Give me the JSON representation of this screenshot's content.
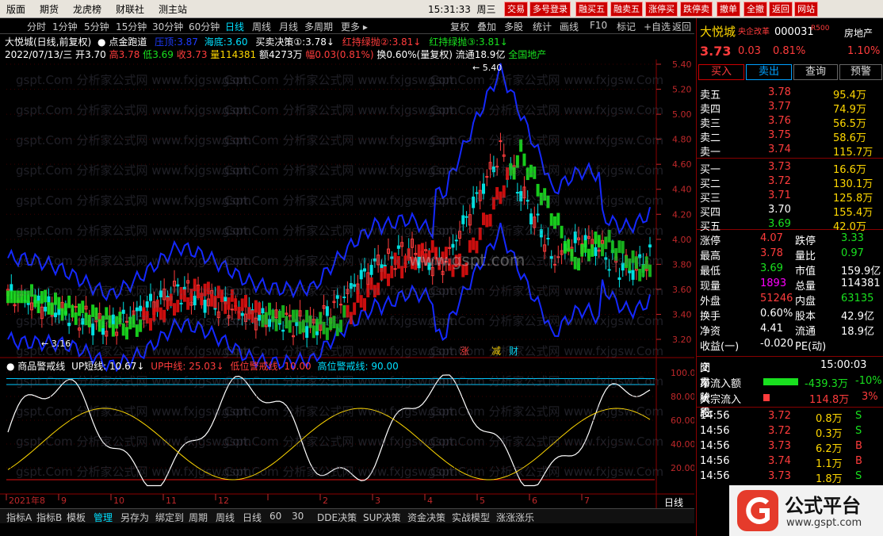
{
  "menu": {
    "items": [
      "版面",
      "期货",
      "龙虎榜",
      "财联社",
      "测主站"
    ],
    "clock": "15:31:33",
    "weekday": "周三"
  },
  "top_buttons": [
    "交易",
    "多号登录",
    "融买五",
    "融卖五",
    "涨停买",
    "跌停卖",
    "撤单",
    "全撤",
    "返回",
    "网站"
  ],
  "toolbar": {
    "items": [
      "分时",
      "1分钟",
      "5分钟",
      "15分钟",
      "30分钟",
      "60分钟",
      "日线",
      "周线",
      "月线",
      "多周期",
      "更多"
    ],
    "active": "日线",
    "right_items": [
      "复权",
      "叠加",
      "多股",
      "统计",
      "画线",
      "F10",
      "标记",
      "+自选",
      "返回"
    ]
  },
  "chart_header": {
    "title": "大悦城(日线,前复权)",
    "indicator": "点金跑道",
    "v1_label": "压顶:",
    "v1": "3.87",
    "v2_label": "海底:",
    "v2": "3.60",
    "v3_label": "买卖决策①:",
    "v3": "3.78",
    "v4_label": "红持绿抛②:",
    "v4": "3.81",
    "v5_label": "红持绿抛③:",
    "v5": "3.81",
    "date": "2022/07/13/三",
    "open_label": "开",
    "open": "3.70",
    "high_label": "高",
    "high": "3.78",
    "low_label": "低",
    "low": "3.69",
    "close_label": "收",
    "close": "3.73",
    "vol_label": "量",
    "vol": "114381",
    "amt_label": "额",
    "amt": "4273万",
    "chg_label": "幅",
    "chg": "0.03(0.81%)",
    "turn": "换0.60%(量复权)",
    "float": "流通18.9亿",
    "sector": "全国地产"
  },
  "price_axis": [
    "5.40",
    "5.20",
    "5.00",
    "4.80",
    "4.60",
    "4.40",
    "4.20",
    "4.00",
    "3.80",
    "3.60",
    "3.40",
    "3.20"
  ],
  "annotations": {
    "max": "5.40",
    "min": "3.16",
    "tags": [
      "涨",
      "减",
      "财"
    ],
    "site": "www.gspt.com"
  },
  "sub_indicator": {
    "name": "商品警戒线",
    "up_short_label": "UP短线:",
    "up_short": "10.67",
    "up_mid_label": "UP中线:",
    "up_mid": "25.03",
    "low_warn_label": "低位警戒线:",
    "low_warn": "10.00",
    "high_warn_label": "高位警戒线:",
    "high_warn": "90.00"
  },
  "sub_axis": [
    "100.0",
    "80.00",
    "60.00",
    "40.00",
    "20.00"
  ],
  "months": [
    "2021年8",
    "9",
    "10",
    "11",
    "12",
    "",
    "2",
    "3",
    "4",
    "5",
    "6",
    "7"
  ],
  "period_label": "日线",
  "bottom_tabs": [
    "指标A",
    "指标B",
    "模板",
    "管理",
    "另存为",
    "绑定到",
    "周期",
    "周线",
    "日线",
    "60",
    "30",
    "DDE决策",
    "SUP决策",
    "资金决策",
    "实战模型",
    "涨涨涨乐"
  ],
  "quote": {
    "name": "大悦城",
    "badge": "央企改革",
    "code": "000031",
    "r_label": "R500",
    "sector": "房地产",
    "price": "3.73",
    "change": "0.03",
    "pct": "0.81%",
    "sector_pct": "1.10%",
    "buttons": [
      "买入",
      "卖出",
      "查询",
      "预警"
    ],
    "asks": [
      {
        "l": "卖五",
        "p": "3.78",
        "v": "95.4万"
      },
      {
        "l": "卖四",
        "p": "3.77",
        "v": "74.9万"
      },
      {
        "l": "卖三",
        "p": "3.76",
        "v": "56.5万"
      },
      {
        "l": "卖二",
        "p": "3.75",
        "v": "58.6万"
      },
      {
        "l": "卖一",
        "p": "3.74",
        "v": "115.7万"
      }
    ],
    "bids": [
      {
        "l": "买一",
        "p": "3.73",
        "v": "16.6万"
      },
      {
        "l": "买二",
        "p": "3.72",
        "v": "130.1万"
      },
      {
        "l": "买三",
        "p": "3.71",
        "v": "125.8万"
      },
      {
        "l": "买四",
        "p": "3.70",
        "v": "155.4万"
      },
      {
        "l": "买五",
        "p": "3.69",
        "v": "42.0万"
      }
    ],
    "stats": [
      {
        "a": "涨停",
        "av": "4.07",
        "b": "跌停",
        "bv": "3.33"
      },
      {
        "a": "最高",
        "av": "3.78",
        "b": "量比",
        "bv": "0.97"
      },
      {
        "a": "最低",
        "av": "3.69",
        "b": "市值",
        "bv": "159.9亿"
      },
      {
        "a": "现量",
        "av": "1893",
        "b": "总量",
        "bv": "114381"
      },
      {
        "a": "外盘",
        "av": "51246",
        "b": "内盘",
        "bv": "63135"
      },
      {
        "a": "换手",
        "av": "0.60%",
        "b": "股本",
        "bv": "42.9亿"
      },
      {
        "a": "净资",
        "av": "4.41",
        "b": "流通",
        "bv": "18.9亿"
      },
      {
        "a": "收益(一)",
        "av": "-0.020",
        "b": "PE(动)",
        "bv": ""
      }
    ],
    "trade_status_label": "交易状态:",
    "trade_status": "闭市阶段",
    "trade_time": "15:00:03",
    "net_inflow_label": "净流入额",
    "net_inflow": "-439.3万",
    "net_inflow_pct": "-10%",
    "block_inflow_label": "大宗流入",
    "block_inflow": "114.8万",
    "block_inflow_pct": "3%",
    "ticks": [
      {
        "t": "14:56",
        "p": "3.72",
        "v": "0.8万",
        "s": "S"
      },
      {
        "t": "14:56",
        "p": "3.72",
        "v": "0.3万",
        "s": "S"
      },
      {
        "t": "14:56",
        "p": "3.73",
        "v": "6.2万",
        "s": "B"
      },
      {
        "t": "14:56",
        "p": "3.74",
        "v": "1.1万",
        "s": "B"
      },
      {
        "t": "14:56",
        "p": "3.73",
        "v": "1.8万",
        "s": "S"
      }
    ]
  },
  "logo": {
    "text": "公式平台",
    "url": "www.gspt.com"
  },
  "watermark": "gspt.Com 分析家公式网 www.fxjgsw.Com",
  "colors": {
    "up": "#ff3c3c",
    "down": "#00e0e0",
    "accent": "#00e0ff",
    "green": "#19e01f",
    "blue": "#1428ff"
  }
}
